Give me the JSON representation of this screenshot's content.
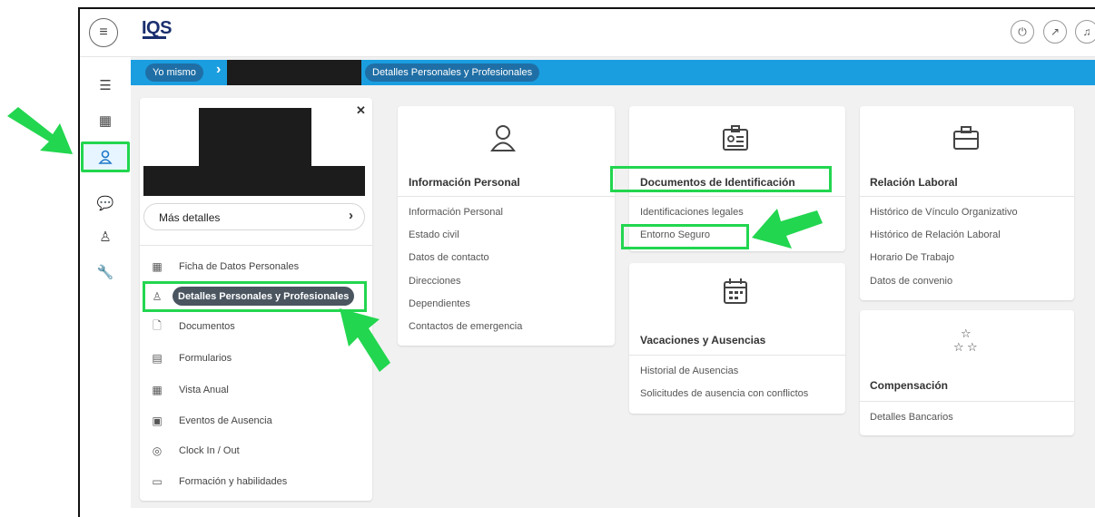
{
  "app": {
    "logo": "IQS",
    "menu_icon": "hamburger-icon"
  },
  "topbar": {
    "icons": [
      "logout-icon",
      "external-link-icon",
      "bell-icon"
    ]
  },
  "sidebar": {
    "icons": [
      "list-icon",
      "calendar-icon",
      "person-icon",
      "chat-icon",
      "person-search-icon",
      "wrench-icon"
    ]
  },
  "breadcrumb": {
    "items": [
      "Yo mismo",
      "Detalles Personales y Profesionales"
    ]
  },
  "profile": {
    "more_details": "Más detalles",
    "menu": [
      {
        "label": "Ficha de Datos Personales",
        "icon": "grid-icon"
      },
      {
        "label": "Detalles Personales y Profesionales",
        "icon": "person-icon"
      },
      {
        "label": "Documentos",
        "icon": "document-icon"
      },
      {
        "label": "Formularios",
        "icon": "form-icon"
      },
      {
        "label": "Vista Anual",
        "icon": "calendar-icon"
      },
      {
        "label": "Eventos de Ausencia",
        "icon": "calendar-event-icon"
      },
      {
        "label": "Clock In / Out",
        "icon": "clock-icon"
      },
      {
        "label": "Formación y habilidades",
        "icon": "book-icon"
      }
    ]
  },
  "cards": {
    "personal": {
      "title": "Información Personal",
      "items": [
        "Información Personal",
        "Estado civil",
        "Datos de contacto",
        "Direcciones",
        "Dependientes",
        "Contactos de emergencia"
      ]
    },
    "identification": {
      "title": "Documentos de Identificación",
      "items": [
        "Identificaciones legales",
        "Entorno Seguro"
      ]
    },
    "vacations": {
      "title": "Vacaciones y Ausencias",
      "items": [
        "Historial de Ausencias",
        "Solicitudes de ausencia con conflictos"
      ]
    },
    "employment": {
      "title": "Relación Laboral",
      "items": [
        "Histórico de Vínculo Organizativo",
        "Histórico de Relación Laboral",
        "Horario De Trabajo",
        "Datos de convenio"
      ]
    },
    "compensation": {
      "title": "Compensación",
      "items": [
        "Detalles Bancarios"
      ]
    }
  },
  "colors": {
    "accent": "#1a9ee0",
    "highlight": "#22d64f",
    "active_pill": "#4a5560"
  }
}
